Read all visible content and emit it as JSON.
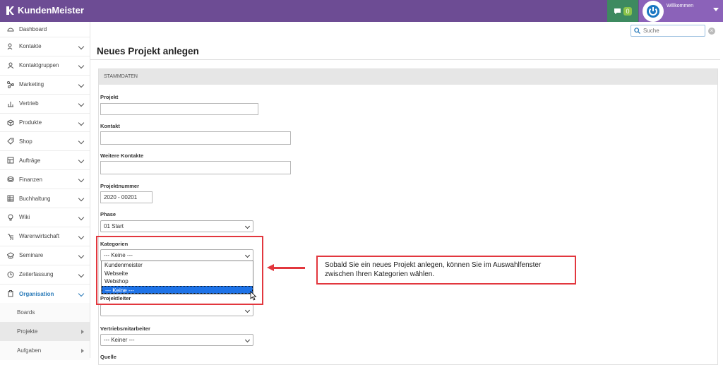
{
  "app": {
    "title": "KundenMeister",
    "welcome": "Willkommen",
    "chat_count": "0"
  },
  "search": {
    "placeholder": "Suche"
  },
  "sidebar": {
    "items": [
      {
        "label": "Dashboard",
        "icon": "dashboard-icon"
      },
      {
        "label": "Kontakte",
        "icon": "contacts-icon"
      },
      {
        "label": "Kontaktgruppen",
        "icon": "contact-groups-icon"
      },
      {
        "label": "Marketing",
        "icon": "marketing-icon"
      },
      {
        "label": "Vertrieb",
        "icon": "sales-icon"
      },
      {
        "label": "Produkte",
        "icon": "products-icon"
      },
      {
        "label": "Shop",
        "icon": "shop-icon"
      },
      {
        "label": "Aufträge",
        "icon": "orders-icon"
      },
      {
        "label": "Finanzen",
        "icon": "finance-icon"
      },
      {
        "label": "Buchhaltung",
        "icon": "accounting-icon"
      },
      {
        "label": "Wiki",
        "icon": "wiki-icon"
      },
      {
        "label": "Warenwirtschaft",
        "icon": "inventory-icon"
      },
      {
        "label": "Seminare",
        "icon": "seminars-icon"
      },
      {
        "label": "Zeiterfassung",
        "icon": "time-tracking-icon"
      },
      {
        "label": "Organisation",
        "icon": "organisation-icon"
      }
    ],
    "sub_items": [
      {
        "label": "Boards"
      },
      {
        "label": "Projekte"
      },
      {
        "label": "Aufgaben"
      }
    ]
  },
  "page": {
    "title": "Neues Projekt anlegen",
    "section": "STAMMDATEN"
  },
  "form": {
    "projekt_label": "Projekt",
    "kontakt_label": "Kontakt",
    "weitere_kontakte_label": "Weitere Kontakte",
    "projektnummer_label": "Projektnummer",
    "projektnummer_value": "2020 - 00201",
    "phase_label": "Phase",
    "phase_value": "01 Start",
    "kategorien_label": "Kategorien",
    "kategorien_value": "--- Keine ---",
    "kategorien_options": [
      "Kundenmeister",
      "Webseite",
      "Webshop",
      "--- Keine ---"
    ],
    "projektleiter_label": "Projektleiter",
    "vertriebsmitarbeiter_label": "Vertriebsmitarbeiter",
    "vertriebsmitarbeiter_value": "--- Keiner ---",
    "quelle_label": "Quelle"
  },
  "callout": {
    "text": "Sobald Sie ein neues Projekt anlegen, können Sie im Auswahlfenster zwischen Ihren Kategorien wählen."
  },
  "colors": {
    "topbar": "#6d4c94",
    "accent": "#2b7bb9",
    "highlight": "#e2373e"
  }
}
